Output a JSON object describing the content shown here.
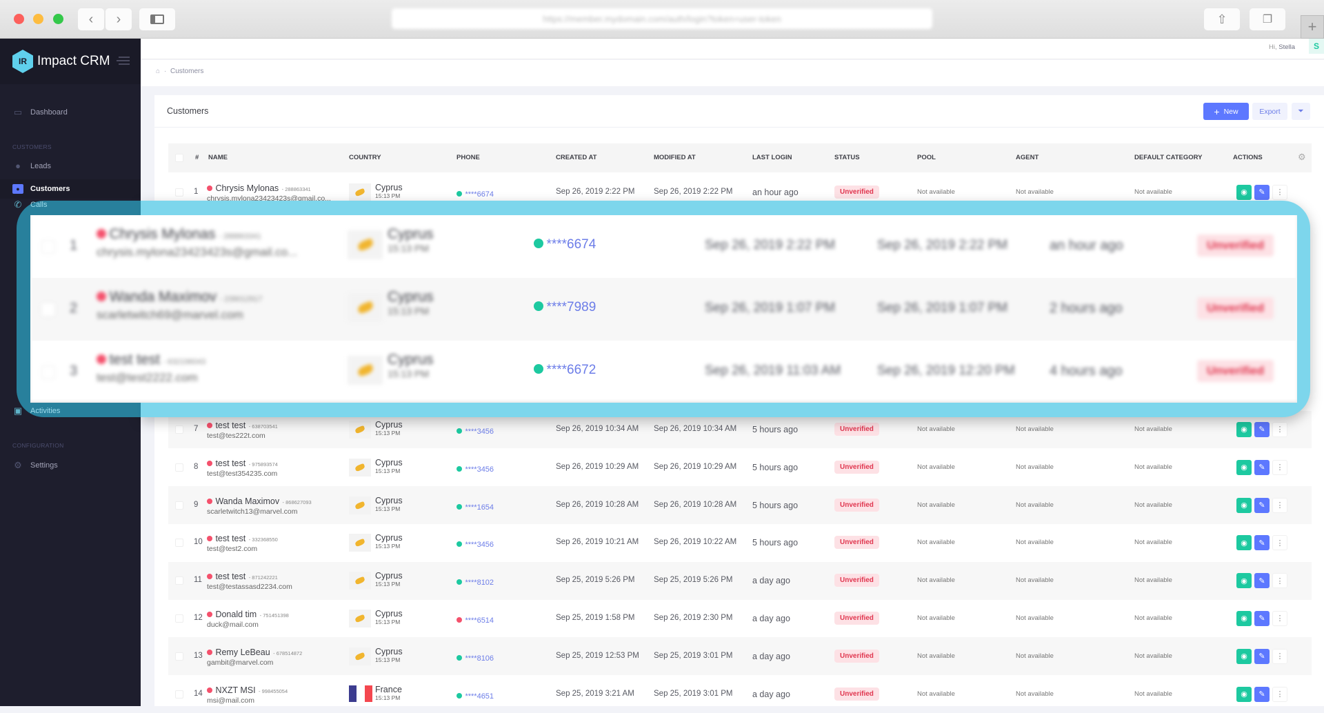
{
  "browser": {
    "url": "https://member.mydomain.com/auth/login?token=user-token"
  },
  "app": {
    "name": "Impact CRM",
    "logo_letters": "IR"
  },
  "user": {
    "greeting": "Hi,",
    "name": "Stella",
    "avatar": "S"
  },
  "sidebar": {
    "dashboard": "Dashboard",
    "section_customers": "CUSTOMERS",
    "leads": "Leads",
    "customers": "Customers",
    "calls": "Calls",
    "activities": "Activities",
    "section_config": "CONFIGURATION",
    "settings": "Settings"
  },
  "breadcrumb": {
    "current": "Customers"
  },
  "card": {
    "title": "Customers",
    "new_label": "New",
    "export_label": "Export"
  },
  "table": {
    "headers": [
      "#",
      "NAME",
      "COUNTRY",
      "PHONE",
      "CREATED AT",
      "MODIFIED AT",
      "LAST LOGIN",
      "STATUS",
      "POOL",
      "AGENT",
      "DEFAULT CATEGORY",
      "ACTIONS"
    ],
    "rows": [
      {
        "num": "1",
        "name": "Chrysis Mylonas",
        "id": "288863341",
        "email": "chrysis.mylona23423423s@gmail.co...",
        "country": "Cyprus",
        "flag": "cy",
        "time": "15:13 PM",
        "phone": "****6674",
        "phone_status": "green",
        "created": "Sep 26, 2019 2:22 PM",
        "modified": "Sep 26, 2019 2:22 PM",
        "last_login": "an hour ago",
        "status": "Unverified",
        "pool": "Not available",
        "agent": "Not available",
        "category": "Not available"
      },
      {
        "num": "7",
        "name": "test test",
        "id": "638703541",
        "email": "test@tes222t.com",
        "country": "Cyprus",
        "flag": "cy",
        "time": "15:13 PM",
        "phone": "****3456",
        "phone_status": "green",
        "created": "Sep 26, 2019 10:34 AM",
        "modified": "Sep 26, 2019 10:34 AM",
        "last_login": "5 hours ago",
        "status": "Unverified",
        "pool": "Not available",
        "agent": "Not available",
        "category": "Not available"
      },
      {
        "num": "8",
        "name": "test test",
        "id": "975893574",
        "email": "test@test354235.com",
        "country": "Cyprus",
        "flag": "cy",
        "time": "15:13 PM",
        "phone": "****3456",
        "phone_status": "green",
        "created": "Sep 26, 2019 10:29 AM",
        "modified": "Sep 26, 2019 10:29 AM",
        "last_login": "5 hours ago",
        "status": "Unverified",
        "pool": "Not available",
        "agent": "Not available",
        "category": "Not available"
      },
      {
        "num": "9",
        "name": "Wanda Maximov",
        "id": "868627093",
        "email": "scarletwitch13@marvel.com",
        "country": "Cyprus",
        "flag": "cy",
        "time": "15:13 PM",
        "phone": "****1654",
        "phone_status": "green",
        "created": "Sep 26, 2019 10:28 AM",
        "modified": "Sep 26, 2019 10:28 AM",
        "last_login": "5 hours ago",
        "status": "Unverified",
        "pool": "Not available",
        "agent": "Not available",
        "category": "Not available"
      },
      {
        "num": "10",
        "name": "test test",
        "id": "332368550",
        "email": "test@test2.com",
        "country": "Cyprus",
        "flag": "cy",
        "time": "15:13 PM",
        "phone": "****3456",
        "phone_status": "green",
        "created": "Sep 26, 2019 10:21 AM",
        "modified": "Sep 26, 2019 10:22 AM",
        "last_login": "5 hours ago",
        "status": "Unverified",
        "pool": "Not available",
        "agent": "Not available",
        "category": "Not available"
      },
      {
        "num": "11",
        "name": "test test",
        "id": "871242221",
        "email": "test@testassasd2234.com",
        "country": "Cyprus",
        "flag": "cy",
        "time": "15:13 PM",
        "phone": "****8102",
        "phone_status": "green",
        "created": "Sep 25, 2019 5:26 PM",
        "modified": "Sep 25, 2019 5:26 PM",
        "last_login": "a day ago",
        "status": "Unverified",
        "pool": "Not available",
        "agent": "Not available",
        "category": "Not available"
      },
      {
        "num": "12",
        "name": "Donald tim",
        "id": "751451398",
        "email": "duck@mail.com",
        "country": "Cyprus",
        "flag": "cy",
        "time": "15:13 PM",
        "phone": "****6514",
        "phone_status": "red",
        "created": "Sep 25, 2019 1:58 PM",
        "modified": "Sep 26, 2019 2:30 PM",
        "last_login": "a day ago",
        "status": "Unverified",
        "pool": "Not available",
        "agent": "Not available",
        "category": "Not available"
      },
      {
        "num": "13",
        "name": "Remy LeBeau",
        "id": "678514872",
        "email": "gambit@marvel.com",
        "country": "Cyprus",
        "flag": "cy",
        "time": "15:13 PM",
        "phone": "****8106",
        "phone_status": "green",
        "created": "Sep 25, 2019 12:53 PM",
        "modified": "Sep 25, 2019 3:01 PM",
        "last_login": "a day ago",
        "status": "Unverified",
        "pool": "Not available",
        "agent": "Not available",
        "category": "Not available"
      },
      {
        "num": "14",
        "name": "NXZT MSI",
        "id": "998455054",
        "email": "msi@mail.com",
        "country": "France",
        "flag": "fr",
        "time": "15:13 PM",
        "phone": "****4651",
        "phone_status": "green",
        "created": "Sep 25, 2019 3:21 AM",
        "modified": "Sep 25, 2019 3:01 PM",
        "last_login": "a day ago",
        "status": "Unverified",
        "pool": "Not available",
        "agent": "Not available",
        "category": "Not available"
      }
    ]
  },
  "highlight": {
    "rows": [
      {
        "num": "1",
        "name": "Chrysis Mylonas",
        "id": "288863341",
        "email": "chrysis.mylona23423423s@gmail.co...",
        "country": "Cyprus",
        "time": "15:13 PM",
        "phone": "****6674",
        "created": "Sep 26, 2019 2:22 PM",
        "modified": "Sep 26, 2019 2:22 PM",
        "last_login": "an hour ago",
        "status": "Unverified"
      },
      {
        "num": "2",
        "name": "Wanda Maximov",
        "id": "239012917",
        "email": "scarletwitch69@marvel.com",
        "country": "Cyprus",
        "time": "15:13 PM",
        "phone": "****7989",
        "created": "Sep 26, 2019 1:07 PM",
        "modified": "Sep 26, 2019 1:07 PM",
        "last_login": "2 hours ago",
        "status": "Unverified"
      },
      {
        "num": "3",
        "name": "test test",
        "id": "632196043",
        "email": "test@test2222.com",
        "country": "Cyprus",
        "time": "15:13 PM",
        "phone": "****6672",
        "created": "Sep 26, 2019 11:03 AM",
        "modified": "Sep 26, 2019 12:20 PM",
        "last_login": "4 hours ago",
        "status": "Unverified"
      }
    ]
  },
  "colors": {
    "accent": "#5d78ff",
    "green": "#1dc9a0",
    "red": "#f4516c",
    "highlight": "#7dd6ec",
    "sidebar": "#1e1e2d"
  }
}
